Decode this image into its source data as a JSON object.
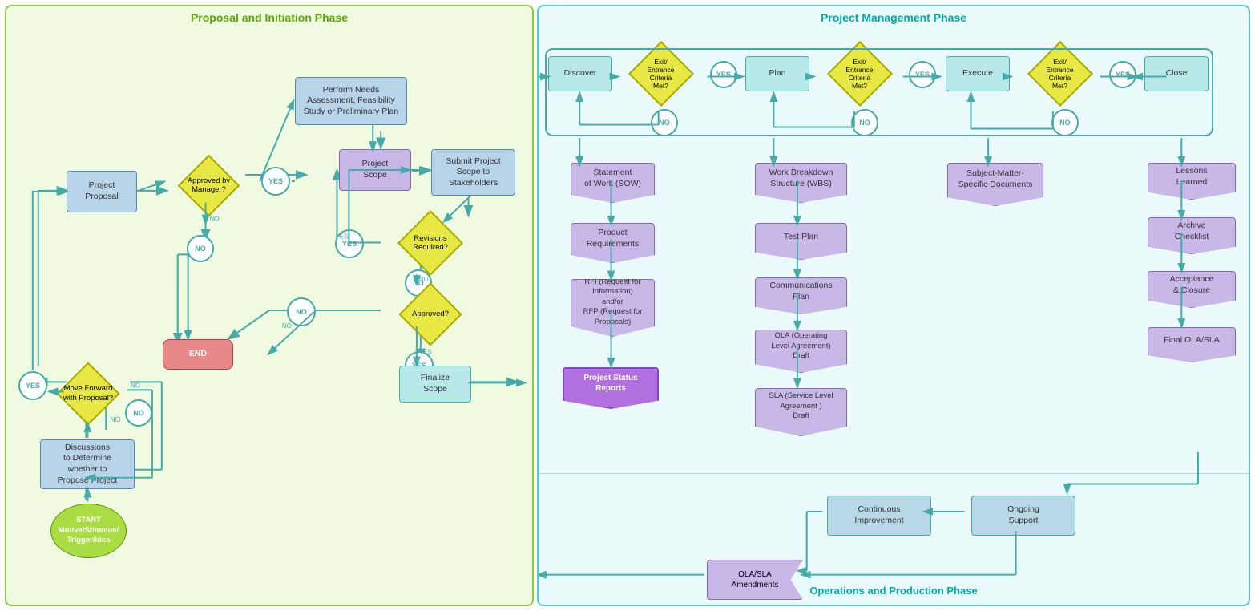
{
  "leftPanel": {
    "title": "Proposal and Initiation Phase",
    "nodes": {
      "start": "START\nMotive/Stimulus/\nTrigger/Idea",
      "discussions": "Discussions\nto Determine\nwhether to\nPropose Project",
      "moveForward": "Move Forward\nwith Proposal?",
      "yes1": "YES",
      "no1": "NO",
      "projectProposal": "Project\nProposal",
      "approvedByManager": "Approved by\nManager?",
      "yes2": "YES",
      "no2": "NO",
      "performNeeds": "Perform Needs\nAssessment, Feasibility\nStudy or Preliminary Plan",
      "projectScope": "Project\nScope",
      "submitProjectScope": "Submit Project\nScope to\nStakeholders",
      "revisionsRequired": "Revisions\nRequired?",
      "yes3": "YES",
      "no3": "NO",
      "approved": "Approved?",
      "yes4": "YES",
      "no4": "NO",
      "end": "END",
      "finalizeScope": "Finalize\nScope"
    }
  },
  "rightPanel": {
    "title": "Project Management Phase",
    "phases": {
      "discover": "Discover",
      "exitEntrance1": "Exit/\nEntrance\nCriteria\nMet?",
      "yes_d": "YES",
      "no_d": "NO",
      "plan": "Plan",
      "exitEntrance2": "Exit/\nEntrance\nCriteria\nMet?",
      "yes_p": "YES",
      "no_p": "NO",
      "execute": "Execute",
      "exitEntrance3": "Exit/\nEntrance\nCriteria\nMet?",
      "yes_e": "YES",
      "no_e": "NO",
      "close": "Close"
    },
    "discoverDocs": {
      "sow": "Statement\nof Work (SOW)",
      "productReqs": "Product\nRequirements",
      "rfi": "RFI (Request for\nInformation)\nand/or\nRFP (Request for\nProposals)",
      "statusReports": "Project Status\nReports"
    },
    "planDocs": {
      "wbs": "Work Breakdown\nStructure (WBS)",
      "testPlan": "Test Plan",
      "commsPlan": "Communications\nPlan",
      "ola": "OLA (Operating\nLevel Agreement)\nDraft",
      "sla": "SLA (Service Level\nAgreement )\nDraft"
    },
    "executeDocs": {
      "subjectMatter": "Subject-Matter-\nSpecific Documents"
    },
    "closeDocs": {
      "lessonsLearned": "Lessons\nLearned",
      "archiveChecklist": "Archive\nChecklist",
      "acceptanceClosure": "Acceptance\n& Closure",
      "finalOla": "Final OLA/SLA"
    },
    "bottomPhase": {
      "title": "Operations and Production Phase",
      "continuousImprovement": "Continuous\nImprovement",
      "ongoingSupport": "Ongoing\nSupport",
      "olaSlaAmendments": "OLA/SLA\nAmendments"
    }
  }
}
